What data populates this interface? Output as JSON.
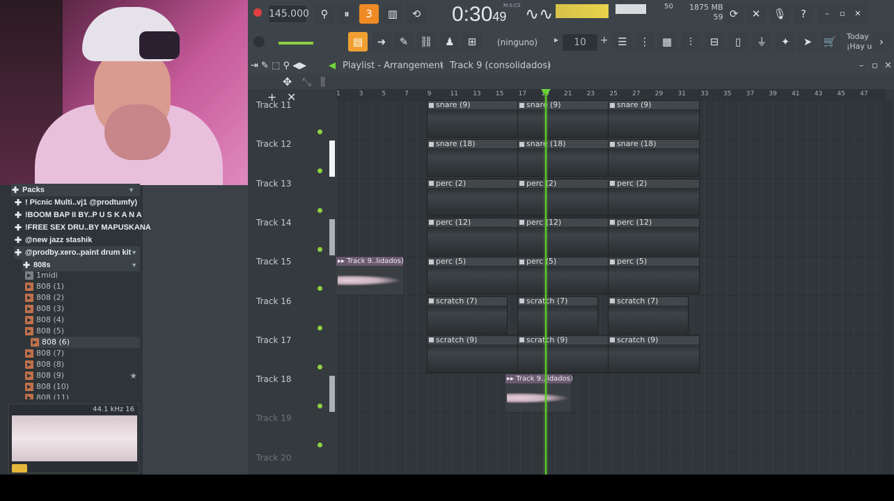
{
  "toolbar": {
    "tempo": "145.000",
    "time": "0:30",
    "time_sub": "49",
    "time_unit": "M:S:CS",
    "cpu": "50",
    "mem": "1875 MB",
    "mem2": "59",
    "pattern": "(ninguno)",
    "snap": "10",
    "today": "Today",
    "today2": "¡Hay u..."
  },
  "playlist": {
    "title": "Playlist - Arrangement",
    "crumb": "Track 9 (consolidados)"
  },
  "ruler": [
    "1",
    "3",
    "5",
    "7",
    "9",
    "11",
    "13",
    "15",
    "17",
    "19",
    "21",
    "23",
    "25",
    "27",
    "29",
    "31",
    "33",
    "35",
    "37",
    "39",
    "41",
    "43",
    "45",
    "47"
  ],
  "browser": {
    "packs": [
      {
        "label": "Packs"
      },
      {
        "label": "! Picnic Multi..vj1 @prodtumfy)"
      },
      {
        "label": "!BOOM BAP II BY..P U S K A N A"
      },
      {
        "label": "!FREE SEX DRU..BY MAPUSKANA"
      },
      {
        "label": "@new jazz stashik"
      },
      {
        "label": "@prodby.xero..paint drum kit"
      },
      {
        "label": "808s"
      }
    ],
    "files": [
      "1midi",
      "808 (1)",
      "808 (2)",
      "808 (3)",
      "808 (4)",
      "808 (5)",
      "808 (6)",
      "808 (7)",
      "808 (8)",
      "808 (9)",
      "808 (10)",
      "808 (11)"
    ],
    "preview": "44.1 kHz 16"
  },
  "tracks": [
    "Track 11",
    "Track 12",
    "Track 13",
    "Track 14",
    "Track 15",
    "Track 16",
    "Track 17",
    "Track 18",
    "Track 19",
    "Track 20"
  ],
  "clips": [
    {
      "row": 0,
      "items": [
        "snare (9)",
        "snare (9)",
        "snare (9)"
      ]
    },
    {
      "row": 1,
      "items": [
        "snare (18)",
        "snare (18)",
        "snare (18)"
      ]
    },
    {
      "row": 2,
      "items": [
        "perc (2)",
        "perc (2)",
        "perc (2)"
      ]
    },
    {
      "row": 3,
      "items": [
        "perc (12)",
        "perc (12)",
        "perc (12)"
      ]
    },
    {
      "row": 4,
      "items": [
        "perc (5)",
        "perc (5)",
        "perc (5)"
      ]
    },
    {
      "row": 5,
      "items": [
        "scratch (7)",
        "scratch (7)",
        "scratch (7)"
      ]
    },
    {
      "row": 6,
      "items": [
        "scratch (9)",
        "scratch (9)",
        "scratch (9)"
      ]
    }
  ],
  "audio_clips": [
    "Track 9..lidados)",
    "Track 9..lidados)"
  ]
}
